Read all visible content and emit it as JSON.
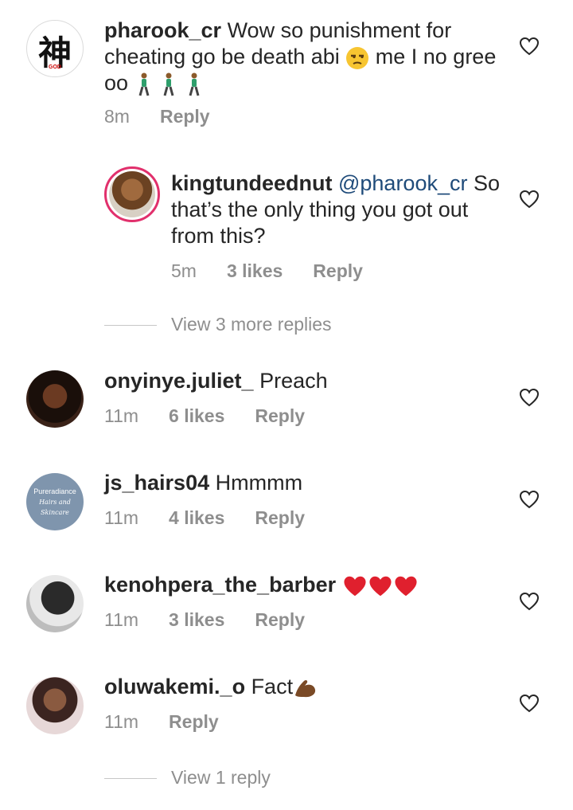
{
  "comments": [
    {
      "username": "pharook_cr",
      "text": " Wow so punishment for cheating go be death abi ",
      "text_after_emoji": " me I no gree oo",
      "avatar_glyph": "神",
      "avatar_caption": "GOD",
      "time": "8m",
      "reply": "Reply"
    },
    {
      "username": "kingtundeednut",
      "mention": " @pharook_cr",
      "text": " So that’s the only thing you got out from this?",
      "time": "5m",
      "likes": "3 likes",
      "reply": "Reply"
    },
    {
      "username": "onyinye.juliet_",
      "text": " Preach",
      "time": "11m",
      "likes": "6 likes",
      "reply": "Reply"
    },
    {
      "username": "js_hairs04",
      "text": " Hmmmm",
      "avatar_text": [
        "Pureradiance",
        "Hairs and",
        "Skincare"
      ],
      "time": "11m",
      "likes": "4 likes",
      "reply": "Reply"
    },
    {
      "username": "kenohpera_the_barber",
      "text": " ",
      "time": "11m",
      "likes": "3 likes",
      "reply": "Reply"
    },
    {
      "username": "oluwakemi._o",
      "text": " Fact",
      "time": "11m",
      "reply": "Reply"
    }
  ],
  "view_more_replies": "View 3 more replies",
  "view_reply": "View 1 reply",
  "colors": {
    "heart_red": "#e0202e",
    "meta_gray": "#8e8e8e",
    "mention_blue": "#1f4b7a"
  }
}
